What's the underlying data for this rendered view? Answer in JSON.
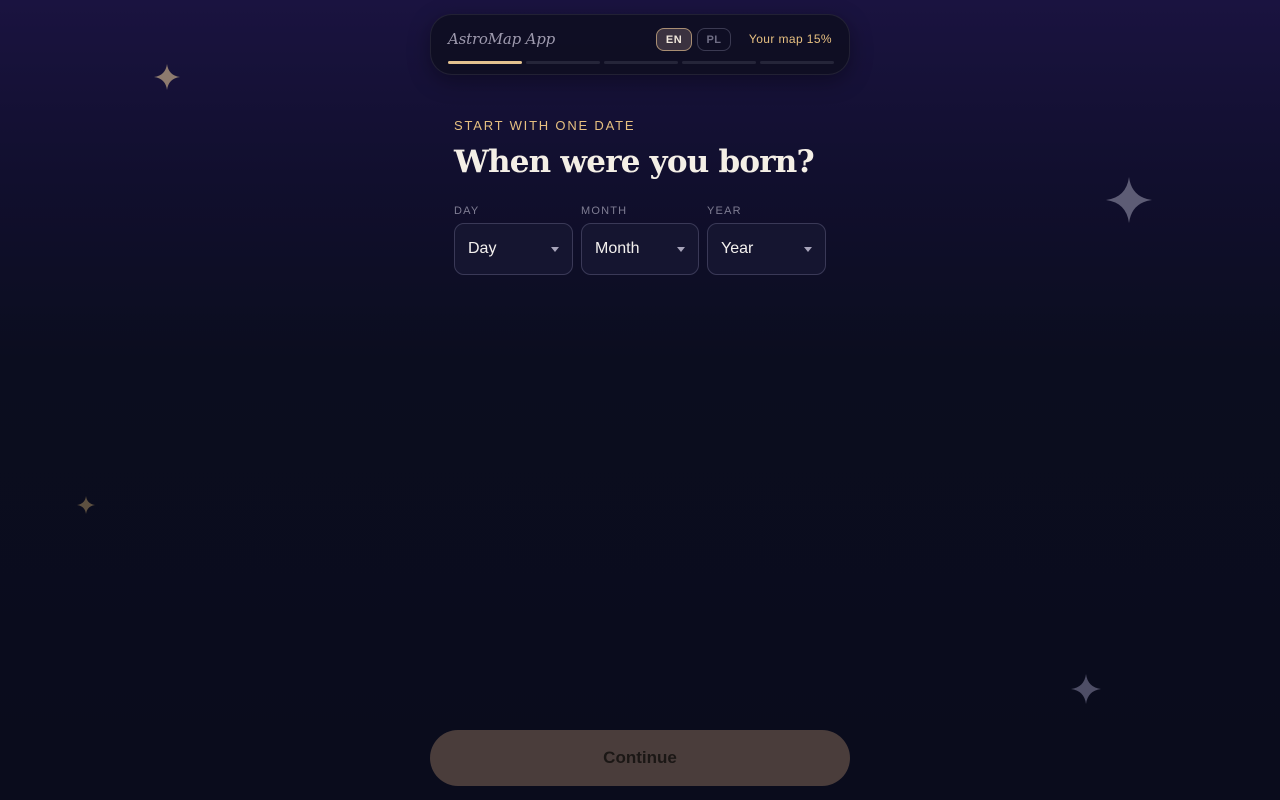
{
  "header": {
    "app_title": "AstroMap App",
    "languages": [
      "EN",
      "PL"
    ],
    "selected_language": "EN",
    "progress_label": "Your map 15%",
    "progress_steps_total": 5,
    "progress_steps_completed": 1
  },
  "main": {
    "eyebrow": "START WITH ONE DATE",
    "headline": "When were you born?",
    "fields": [
      {
        "label": "DAY",
        "value": "Day"
      },
      {
        "label": "MONTH",
        "value": "Month"
      },
      {
        "label": "YEAR",
        "value": "Year"
      }
    ]
  },
  "footer": {
    "continue_label": "Continue"
  },
  "colors": {
    "accent": "#e6bf80",
    "progress_active": "#e3c18f",
    "button_bg": "#4a3d3b"
  }
}
